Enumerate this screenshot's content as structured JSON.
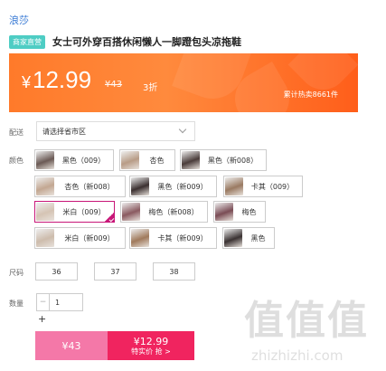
{
  "shop": {
    "name": "浪莎"
  },
  "product": {
    "badge": "商家直营",
    "title": "女士可外穿百搭休闲懒人一脚蹬包头凉拖鞋"
  },
  "price": {
    "currency": "¥",
    "value": "12.99",
    "original": "¥43",
    "discount": "3折",
    "sold": "累计热卖8661件"
  },
  "delivery": {
    "label": "配送",
    "placeholder": "请选择省市区"
  },
  "color": {
    "label": "颜色",
    "options": [
      {
        "text": "黑色（009）",
        "selected": false,
        "tone": "#6b5a55"
      },
      {
        "text": "杏色",
        "selected": false,
        "tone": "#b89c86"
      },
      {
        "text": "黑色（新008）",
        "selected": false,
        "tone": "#4a3c3a"
      },
      {
        "text": "杏色（新008）",
        "selected": false,
        "tone": "#c3a792"
      },
      {
        "text": "黑色（新009）",
        "selected": false,
        "tone": "#3b3030"
      },
      {
        "text": "卡其（009）",
        "selected": false,
        "tone": "#9a7a62"
      },
      {
        "text": "米白（009）",
        "selected": true,
        "tone": "#d5c4b4"
      },
      {
        "text": "梅色（新008）",
        "selected": false,
        "tone": "#8a5a60"
      },
      {
        "text": "梅色",
        "selected": false,
        "tone": "#7a4c55"
      },
      {
        "text": "米白（新009）",
        "selected": false,
        "tone": "#cdbcac"
      },
      {
        "text": "卡其（新009）",
        "selected": false,
        "tone": "#a07a5c"
      },
      {
        "text": "黑色",
        "selected": false,
        "tone": "#3a3232"
      }
    ]
  },
  "size": {
    "label": "尺码",
    "options": [
      "36",
      "37",
      "38"
    ]
  },
  "quantity": {
    "label": "数量",
    "value": "1",
    "minus": "−",
    "plus": "+"
  },
  "actions": {
    "buy_alone": "¥43",
    "buy_group_price": "¥12.99",
    "buy_group_label": "特实价 抢 >"
  },
  "watermark": {
    "big": "值值值",
    "small": "zhizhizhi.com"
  }
}
